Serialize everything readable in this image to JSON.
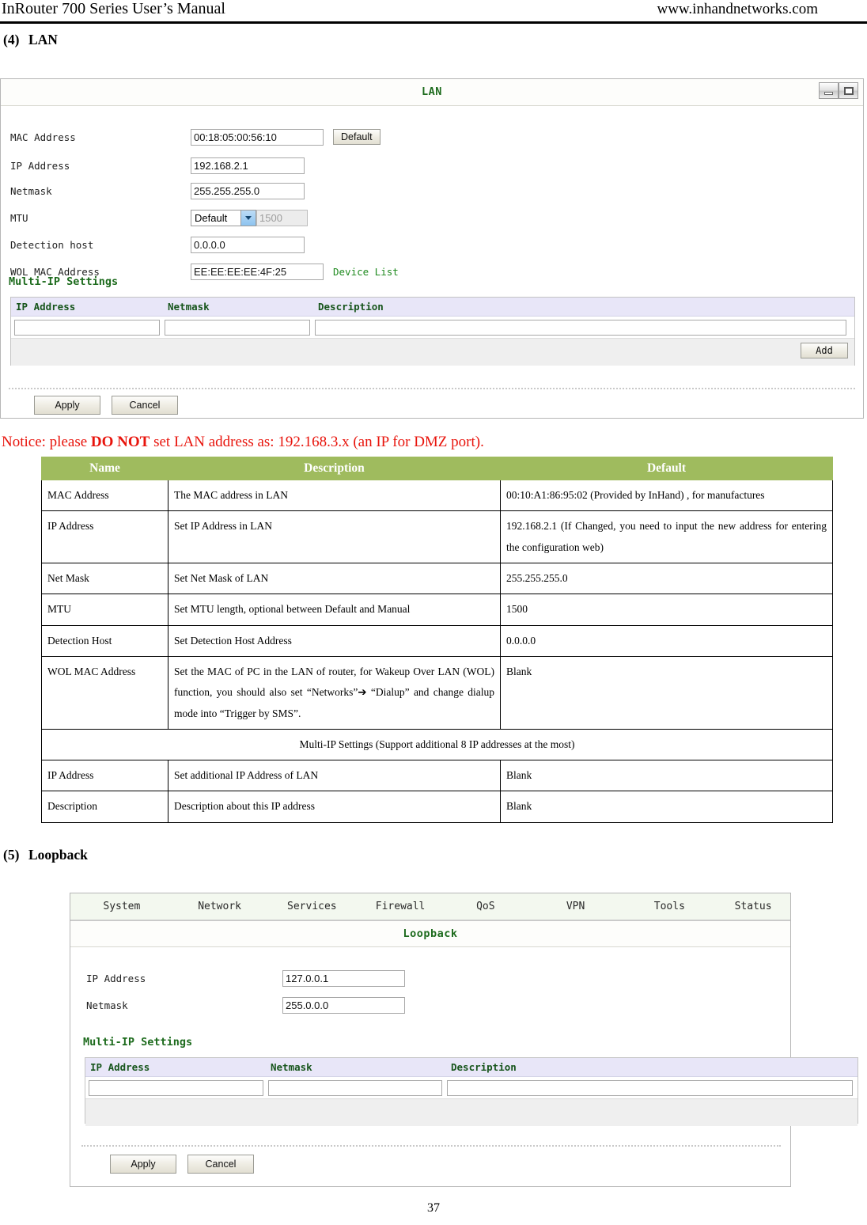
{
  "header": {
    "left": "InRouter 700 Series User’s Manual",
    "right": "www.inhandnetworks.com"
  },
  "sections": {
    "lan": {
      "num": "(4)",
      "title": "LAN"
    },
    "loopback": {
      "num": "(5)",
      "title": "Loopback"
    }
  },
  "lan_panel": {
    "title": "LAN",
    "window_buttons": [
      "minimize-icon",
      "restore-icon"
    ],
    "fields": [
      {
        "label": "MAC Address",
        "value": "00:18:05:00:56:10"
      },
      {
        "label": "IP Address",
        "value": "192.168.2.1"
      },
      {
        "label": "Netmask",
        "value": "255.255.255.0"
      },
      {
        "label": "MTU",
        "value": "1500",
        "select": "Default"
      },
      {
        "label": "Detection host",
        "value": "0.0.0.0"
      },
      {
        "label": "WOL MAC Address",
        "value": "EE:EE:EE:EE:4F:25",
        "link": "Device List"
      }
    ],
    "default_button": "Default",
    "multi_ip": {
      "title": "Multi-IP Settings",
      "columns": [
        "IP Address",
        "Netmask",
        "Description"
      ],
      "row": [
        "",
        "",
        ""
      ],
      "add_button": "Add"
    },
    "apply_button": "Apply",
    "cancel_button": "Cancel"
  },
  "notice": {
    "before": "Notice: please ",
    "strong": "DO NOT",
    "after": " set LAN address as: 192.168.3.x (an IP for DMZ port)."
  },
  "doc_table": {
    "columns": [
      "Name",
      "Description",
      "Default"
    ],
    "rows": [
      {
        "name": "MAC Address",
        "description": "The MAC address in LAN",
        "default": "00:10:A1:86:95:02 (Provided by InHand) , for manufactures"
      },
      {
        "name": "IP Address",
        "description": "Set IP Address in LAN",
        "default": "192.168.2.1 (If Changed, you need to input the new address for entering the configuration web)"
      },
      {
        "name": "Net Mask",
        "description": "Set Net Mask of LAN",
        "default": "255.255.255.0"
      },
      {
        "name": "MTU",
        "description": "Set MTU length, optional between Default and Manual",
        "default": "1500"
      },
      {
        "name": "Detection Host",
        "description": "Set Detection Host Address",
        "default": "0.0.0.0"
      },
      {
        "name": "WOL MAC Address",
        "description": "Set the MAC of PC in the LAN of router, for Wakeup Over LAN (WOL) function, you should also set “Networks”➔ “Dialup” and change dialup mode into “Trigger by SMS”.",
        "default": "Blank"
      }
    ],
    "span_row": "Multi-IP Settings (Support additional 8 IP addresses at the most)",
    "rows2": [
      {
        "name": "IP Address",
        "description": "Set additional IP Address of LAN",
        "default": "Blank"
      },
      {
        "name": "Description",
        "description": "Description about this IP address",
        "default": "Blank"
      }
    ]
  },
  "loopback_panel": {
    "nav_tabs": [
      "System",
      "Network",
      "Services",
      "Firewall",
      "QoS",
      "VPN",
      "Tools",
      "Status"
    ],
    "title": "Loopback",
    "fields": [
      {
        "label": "IP Address",
        "value": "127.0.0.1"
      },
      {
        "label": "Netmask",
        "value": "255.0.0.0"
      }
    ],
    "multi_ip": {
      "title": "Multi-IP Settings",
      "columns": [
        "IP Address",
        "Netmask",
        "Description"
      ],
      "row": [
        "",
        "",
        ""
      ]
    },
    "apply_button": "Apply",
    "cancel_button": "Cancel"
  },
  "page_number": "37",
  "colors": {
    "table_header_green": "#9fbb5e",
    "notice_red": "#e8140c",
    "ui_title_green": "#1d6b1d",
    "link_green": "#1f8a1f",
    "grid_header_lavender": "#e8e6f8"
  }
}
